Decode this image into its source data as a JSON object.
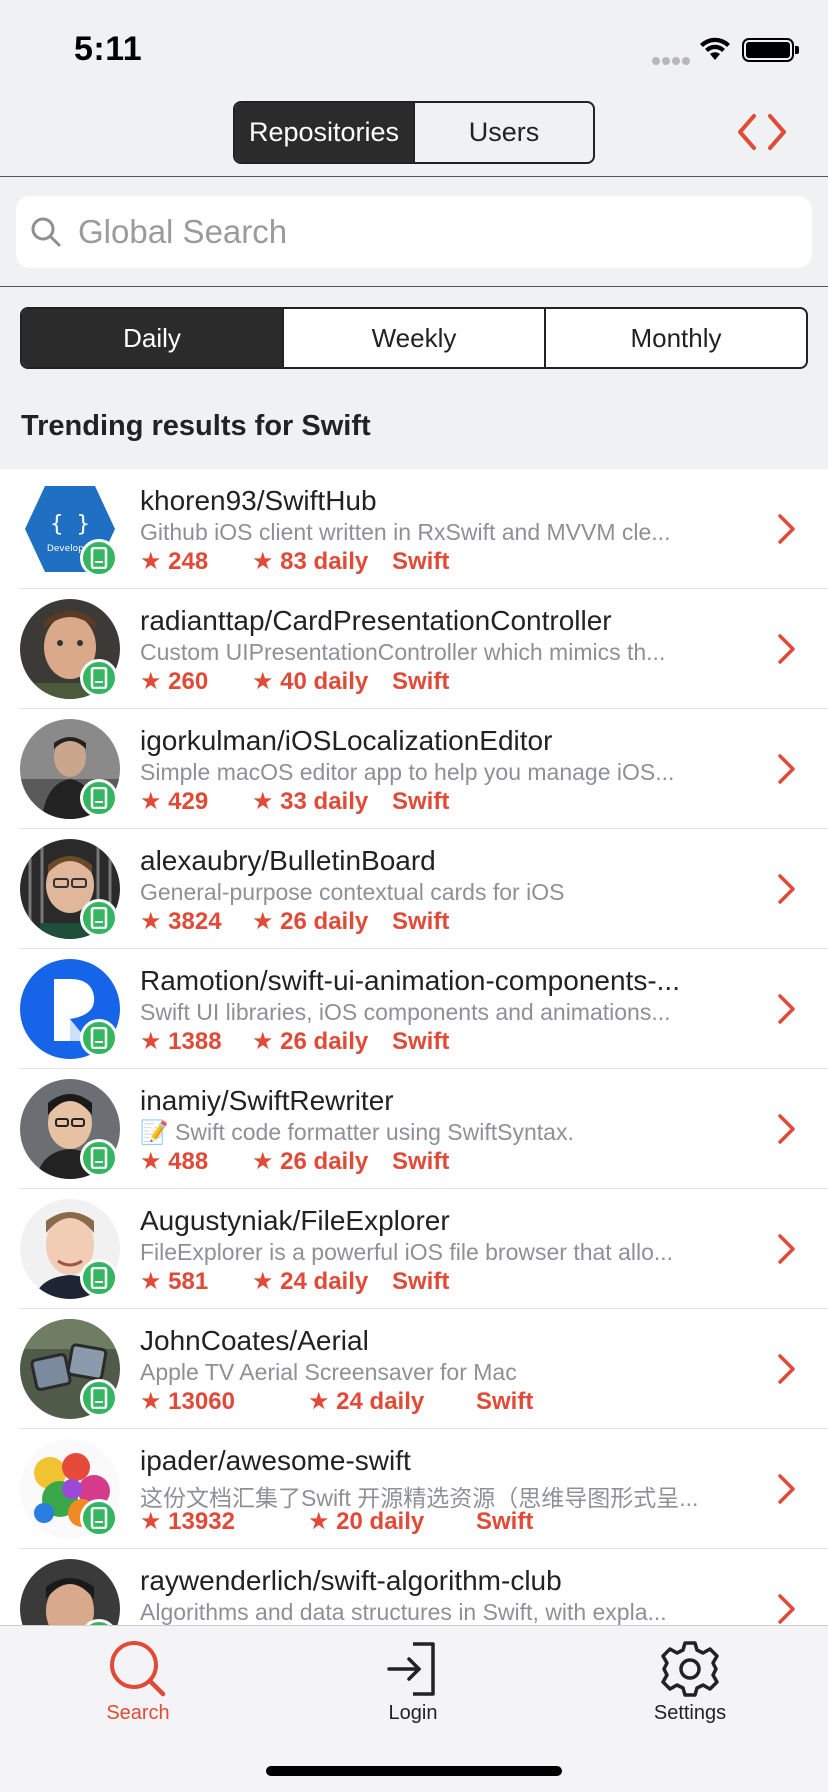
{
  "status_bar": {
    "time": "5:11"
  },
  "nav": {
    "segments": [
      "Repositories",
      "Users"
    ],
    "selected": "Repositories"
  },
  "search": {
    "placeholder": "Global Search"
  },
  "period": {
    "segments": [
      "Daily",
      "Weekly",
      "Monthly"
    ],
    "selected": "Daily"
  },
  "section": {
    "title": "Trending results for Swift"
  },
  "colors": {
    "accent": "#e14a37",
    "dark": "#2b2b2b",
    "badge": "#34b55f"
  },
  "repos": [
    {
      "name": "khoren93/SwiftHub",
      "description": "Github iOS client written in RxSwift and MVVM cle...",
      "stars": "★ 248",
      "daily": "★ 83 daily",
      "language": "Swift"
    },
    {
      "name": "radianttap/CardPresentationController",
      "description": "Custom UIPresentationController which mimics th...",
      "stars": "★ 260",
      "daily": "★ 40 daily",
      "language": "Swift"
    },
    {
      "name": "igorkulman/iOSLocalizationEditor",
      "description": "Simple macOS editor app to help you manage iOS...",
      "stars": "★ 429",
      "daily": "★ 33 daily",
      "language": "Swift"
    },
    {
      "name": "alexaubry/BulletinBoard",
      "description": "General-purpose contextual cards for iOS",
      "stars": "★ 3824",
      "daily": "★ 26 daily",
      "language": "Swift"
    },
    {
      "name": "Ramotion/swift-ui-animation-components-...",
      "description": "Swift UI libraries, iOS components and animations...",
      "stars": "★ 1388",
      "daily": "★ 26 daily",
      "language": "Swift"
    },
    {
      "name": "inamiy/SwiftRewriter",
      "description": "📝 Swift code formatter using SwiftSyntax.",
      "stars": "★ 488",
      "daily": "★ 26 daily",
      "language": "Swift"
    },
    {
      "name": "Augustyniak/FileExplorer",
      "description": "FileExplorer is a powerful iOS file browser that allo...",
      "stars": "★ 581",
      "daily": "★ 24 daily",
      "language": "Swift"
    },
    {
      "name": "JohnCoates/Aerial",
      "description": "Apple TV Aerial Screensaver for Mac",
      "stars": "★ 13060",
      "daily": "★ 24 daily",
      "language": "Swift"
    },
    {
      "name": "ipader/awesome-swift",
      "description": "这份文档汇集了Swift 开源精选资源（思维导图形式呈...",
      "stars": "★ 13932",
      "daily": "★ 20 daily",
      "language": "Swift"
    },
    {
      "name": "raywenderlich/swift-algorithm-club",
      "description": "Algorithms and data structures in Swift, with expla...",
      "stars": "",
      "daily": "",
      "language": ""
    }
  ],
  "tabs": [
    {
      "label": "Search",
      "icon": "search-icon"
    },
    {
      "label": "Login",
      "icon": "login-icon"
    },
    {
      "label": "Settings",
      "icon": "gear-icon"
    }
  ]
}
